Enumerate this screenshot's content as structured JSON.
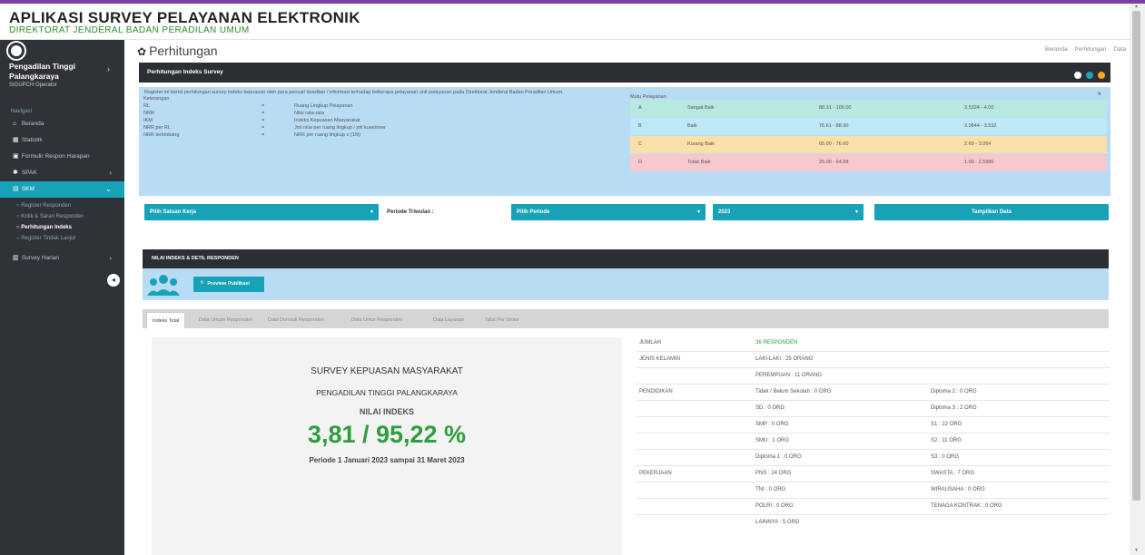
{
  "app": {
    "title": "APLIKASI SURVEY PELAYANAN ELEKTRONIK",
    "subtitle": "DIREKTORAT JENDERAL BADAN PERADILAN UMUM"
  },
  "sidebar": {
    "org": "Pengadilan Tinggi Palangkaraya",
    "role": "SIGUPCH Operator",
    "section": "Navigasi",
    "items": [
      {
        "label": "Beranda",
        "icon": "home-icon"
      },
      {
        "label": "Statistik",
        "icon": "bar-chart-icon"
      },
      {
        "label": "Formulir Respon Harapan",
        "icon": "form-icon"
      },
      {
        "label": "SPAK",
        "icon": "gear-icon"
      },
      {
        "label": "SKM",
        "icon": "document-icon"
      },
      {
        "label": "Survey Harian",
        "icon": "calendar-icon"
      }
    ],
    "subitems": [
      "Register Responden",
      "Kritik & Saran Responden",
      "Perhitungan Indeks",
      "Register Tindak Lanjut"
    ]
  },
  "page": {
    "title": "Perhitungan",
    "breadcrumb": [
      "Beranda",
      "Perhitungan",
      "Data"
    ]
  },
  "survey_box": {
    "title": "Perhitungan Indeks Survey",
    "info": "Register ini berisi perhitungan survey indeks kepuasan oleh para pencari keadilan / informasi terhadap beberapa pelayanan unit pelayanan pada Direktorat Jenderal Badan Peradilan Umum.",
    "legend_heading": "Keterangan",
    "legend": [
      {
        "code": "RL",
        "desc": "Ruang Lingkup Pelayanan"
      },
      {
        "code": "NRR",
        "desc": "Nilai rata-rata"
      },
      {
        "code": "IKM",
        "desc": "Indeks Kepuasan Masyarakat"
      },
      {
        "code": "NRR per RL",
        "desc": "Jml nilai per ruang lingkup / jml kuesioner"
      },
      {
        "code": "NRR tertimbang",
        "desc": "NRR per ruang lingkup x (1/9)"
      }
    ],
    "mutu_label": "Mutu Pelayanan",
    "mutu": [
      {
        "grade": "A",
        "label": "Sangat Baik",
        "range": "88.31 - 100.00",
        "index": "3.5324 - 4.00",
        "color": "#b7e9e0"
      },
      {
        "grade": "B",
        "label": "Baik",
        "range": "76.61 - 88.30",
        "index": "3.0644 - 3.532",
        "color": "#bde8f6"
      },
      {
        "grade": "C",
        "label": "Kurang Baik",
        "range": "65.00 - 76.60",
        "index": "2.60 - 3.064",
        "color": "#fbe0a8"
      },
      {
        "grade": "D",
        "label": "Tidak Baik",
        "range": "25.00 - 64.99",
        "index": "1.00 - 2.5996",
        "color": "#f8c8cf"
      }
    ]
  },
  "filters": {
    "satker": "Pilih Satuan Kerja",
    "periode_label": "Periode Triwulan :",
    "periode": "Pilih Periode",
    "year": "2023",
    "show": "Tampilkan Data"
  },
  "nilai": {
    "heading": "NILAI INDEKS & DETIL RESPONDEN",
    "preview": "Preview Publikasi"
  },
  "tabs": [
    "Indeks Total",
    "Data Umum Responden",
    "Data Domisili Responden",
    "Data Umur Responden",
    "Data Layanan",
    "Nilai Per Unsur"
  ],
  "summary": {
    "title": "SURVEY KEPUASAN MASYARAKAT",
    "court": "PENGADILAN TINGGI PALANGKARAYA",
    "label": "NILAI INDEKS",
    "value": "3,81 / 95,22 %",
    "period": "Periode 1 Januari 2023 sampai 31 Maret 2023"
  },
  "details": [
    {
      "k": "JUMLAH",
      "a": "36 RESPONDEN",
      "b": ""
    },
    {
      "k": "JENIS KELAMIN",
      "a": "LAKI-LAKI : 25 ORANG",
      "b": ""
    },
    {
      "k": "",
      "a": "PEREMPUAN : 11 ORANG",
      "b": ""
    },
    {
      "k": "PENDIDIKAN",
      "a": "Tidak / Belum Sekolah : 0 ORG",
      "b": "Diploma 2 : 0 ORG"
    },
    {
      "k": "",
      "a": "SD : 0 ORG",
      "b": "Diploma 3 : 2 ORG"
    },
    {
      "k": "",
      "a": "SMP : 0 ORG",
      "b": "S1 : 22 ORG"
    },
    {
      "k": "",
      "a": "SMU : 1 ORG",
      "b": "S2 : 11 ORG"
    },
    {
      "k": "",
      "a": "Diploma 1 : 0 ORG",
      "b": "S3 : 0 ORG"
    },
    {
      "k": "PEKERJAAN",
      "a": "PNS : 24 ORG",
      "b": "SWASTA : 7 ORG"
    },
    {
      "k": "",
      "a": "TNI : 0 ORG",
      "b": "WIRAUSAHA : 0 ORG"
    },
    {
      "k": "",
      "a": "POLRI : 0 ORG",
      "b": "TENAGA KONTRAK : 0 ORG"
    },
    {
      "k": "",
      "a": "LAINNYA : 5 ORG",
      "b": ""
    }
  ],
  "colors": {
    "accent": "#17a2b8",
    "dark": "#2b2f33",
    "success": "#2e9e3e",
    "info_bg": "#b9dcf5"
  }
}
